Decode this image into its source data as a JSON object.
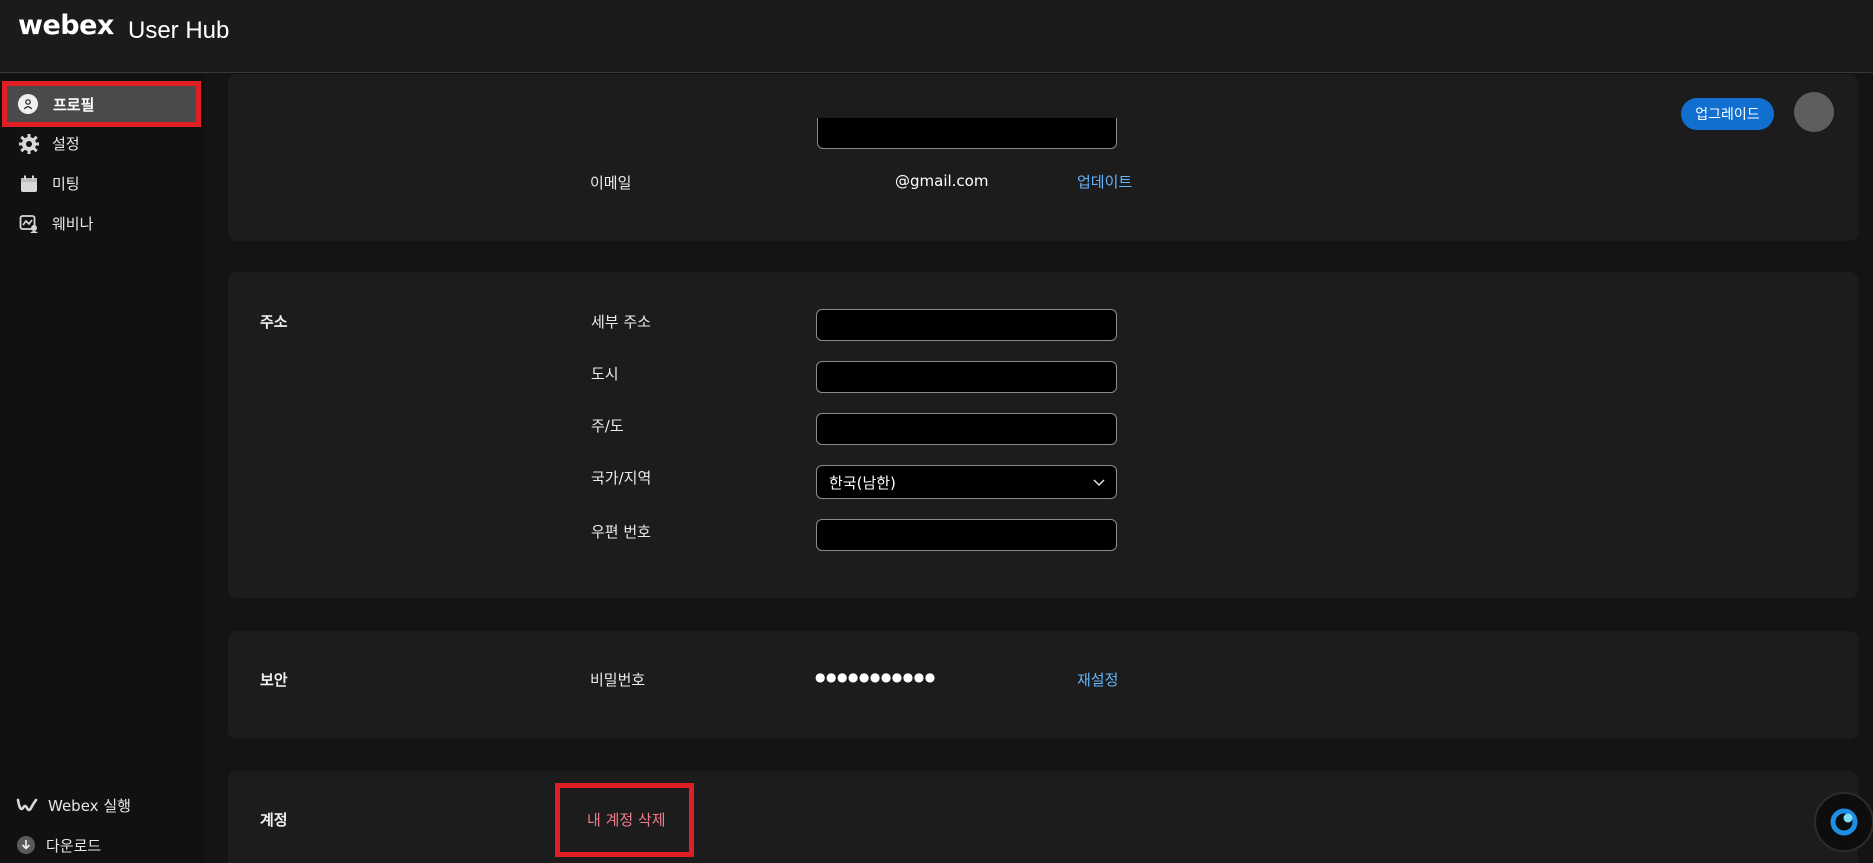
{
  "header": {
    "brand": "webex",
    "app_title": "User Hub"
  },
  "sidebar": {
    "items": [
      {
        "label": "프로필",
        "icon": "profile-icon"
      },
      {
        "label": "설정",
        "icon": "gear-icon"
      },
      {
        "label": "미팅",
        "icon": "calendar-icon"
      },
      {
        "label": "웨비나",
        "icon": "webinar-icon"
      }
    ],
    "bottom": [
      {
        "label": "Webex 실행",
        "icon": "webex-logo-icon"
      },
      {
        "label": "다운로드",
        "icon": "download-icon"
      }
    ]
  },
  "toolbar": {
    "upgrade_label": "업그레이드"
  },
  "email_section": {
    "label": "이메일",
    "value": "@gmail.com",
    "action": "업데이트"
  },
  "address_section": {
    "title": "주소",
    "fields": {
      "detail": {
        "label": "세부 주소",
        "value": ""
      },
      "city": {
        "label": "도시",
        "value": ""
      },
      "state": {
        "label": "주/도",
        "value": ""
      },
      "country": {
        "label": "국가/지역",
        "value": "한국(남한)"
      },
      "postal": {
        "label": "우편 번호",
        "value": ""
      }
    }
  },
  "security_section": {
    "title": "보안",
    "password_label": "비밀번호",
    "password_mask": "●●●●●●●●●●●",
    "action": "재설정"
  },
  "account_section": {
    "title": "계정",
    "delete_label": "내 계정 삭제"
  },
  "colors": {
    "accent": "#1170cf",
    "link": "#64b4fa",
    "danger": "#f27b8a",
    "highlight_box": "#e01e26"
  }
}
